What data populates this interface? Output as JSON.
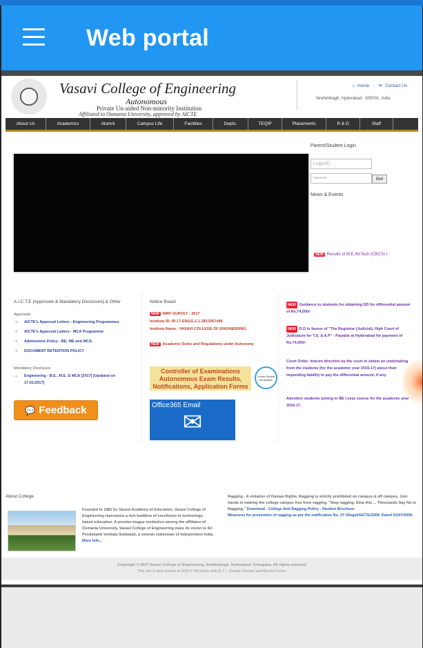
{
  "app": {
    "title": "Web portal"
  },
  "header": {
    "college_name": "Vasavi College of Engineering",
    "autonomous": "Autonomous",
    "private": "Private Un-aided Non-minority Institution",
    "affiliated": "Affiliated to Osmania University, approved by AICTE",
    "home": "Home",
    "contact": "Contact Us",
    "address": "Ibrahimbagh, Hyderabad - 500031, India"
  },
  "nav": [
    "About Us",
    "Academics",
    "Alumni",
    "Campus Life",
    "Facilities",
    "Depts.",
    "TEQIP",
    "Placements",
    "R & D",
    "Staff"
  ],
  "login": {
    "title": "Parent/Student Login",
    "id_placeholder": "LoginID",
    "pw_placeholder": "••••••••",
    "go": "Go!"
  },
  "news": {
    "title": "News & Events",
    "item": "Results of M.E./M.Tech (CBCS) I-"
  },
  "aicte": {
    "title": "A.I.C.T.E [Approvals & Mandatory Disclosure] & Other",
    "approvals": "Approvals",
    "items": [
      "AICTE's Approval Letters - Engineering Programmes",
      "AICTE's Approval Letters - MCA Programme",
      "Admissions Policy - BE, ME and MCA.",
      "DOCUMENT RETENTION POLICY"
    ],
    "mandatory": "Mandatory Disclosure",
    "mandatory_line1": "Engineering - B.E., M.E. & MCA [2017] [Updated on",
    "mandatory_line2": "17.02.2017]",
    "feedback": "Feedback"
  },
  "notice": {
    "title": "Notice Board",
    "new_badge": "NEW",
    "nirf": "NIRF SURVEY - 2017",
    "institute_id": "Institute ID: IR-17-ENGG-1-1-2813267448",
    "institute_name": "Institute Name : VASAVI COLLEGE OF ENGINEERING",
    "rules": "Academic Rules and Regulations under Autonomy",
    "coe_line1": "Controller of Examinations",
    "coe_line2": "Autonomous Exam Results,",
    "coe_line3": "Notifications, Application Forms",
    "online_degree": "Online Degree Verification",
    "office365": "Office365 Email"
  },
  "announcements": {
    "a1": "Guidance to students for obtaining DD for differential amount of Rs.74,000/-",
    "a2": "D.D in favour of \"The Registrar (Judicial), High Court of Judicature for T.S. & A.P\" - Payable at Hyderabad for payment of Rs.74,000/-",
    "a3": "Court Order: Interim direction by the court to obtain an undertaking from the students (for the academic year 2016-17) about their impending liability to pay the differential amount, if any.",
    "a4": "Attention students joining in BE I-year course for the academic year 2016-17."
  },
  "about": {
    "title": "About College",
    "text": "Founded in 1981 by Vasavi Academy of Education, Vasavi College of Engineering represents a rich tradition of excellence in technology-based education. A premier-league institution among the affiliates of Osmania University, Vasavi College of Engineering owes its vision to Sri Pendekanti Venkata Subbaiah, a veteran statesman of Independent India.",
    "more": "More Info..."
  },
  "ragging": {
    "text": "Ragging - A violation of Human Rights. Ragging is strictly prohibited on campus & off campus. Join hands in making the college campus free from ragging. \"Stop ragging. Stop this ... Thousands Say No to Ragging.\"",
    "download": "Download - College Anti Ragging Policy - Student Brochure.",
    "measures": "Measures for prevention of ragging as per the notification No. 37-3/legal/AICTE/2009. Dated 01/07/2009."
  },
  "footer": {
    "line1": "Copyright © 2017 Vasavi College of Engineering, Ibrahimbagh, Hyderabad, Telangana. All rights reserved",
    "line2": "This site is best viewed at 1024 X 768 pixels with IE 7 +, Google Chrome and Mozila Firefox"
  }
}
